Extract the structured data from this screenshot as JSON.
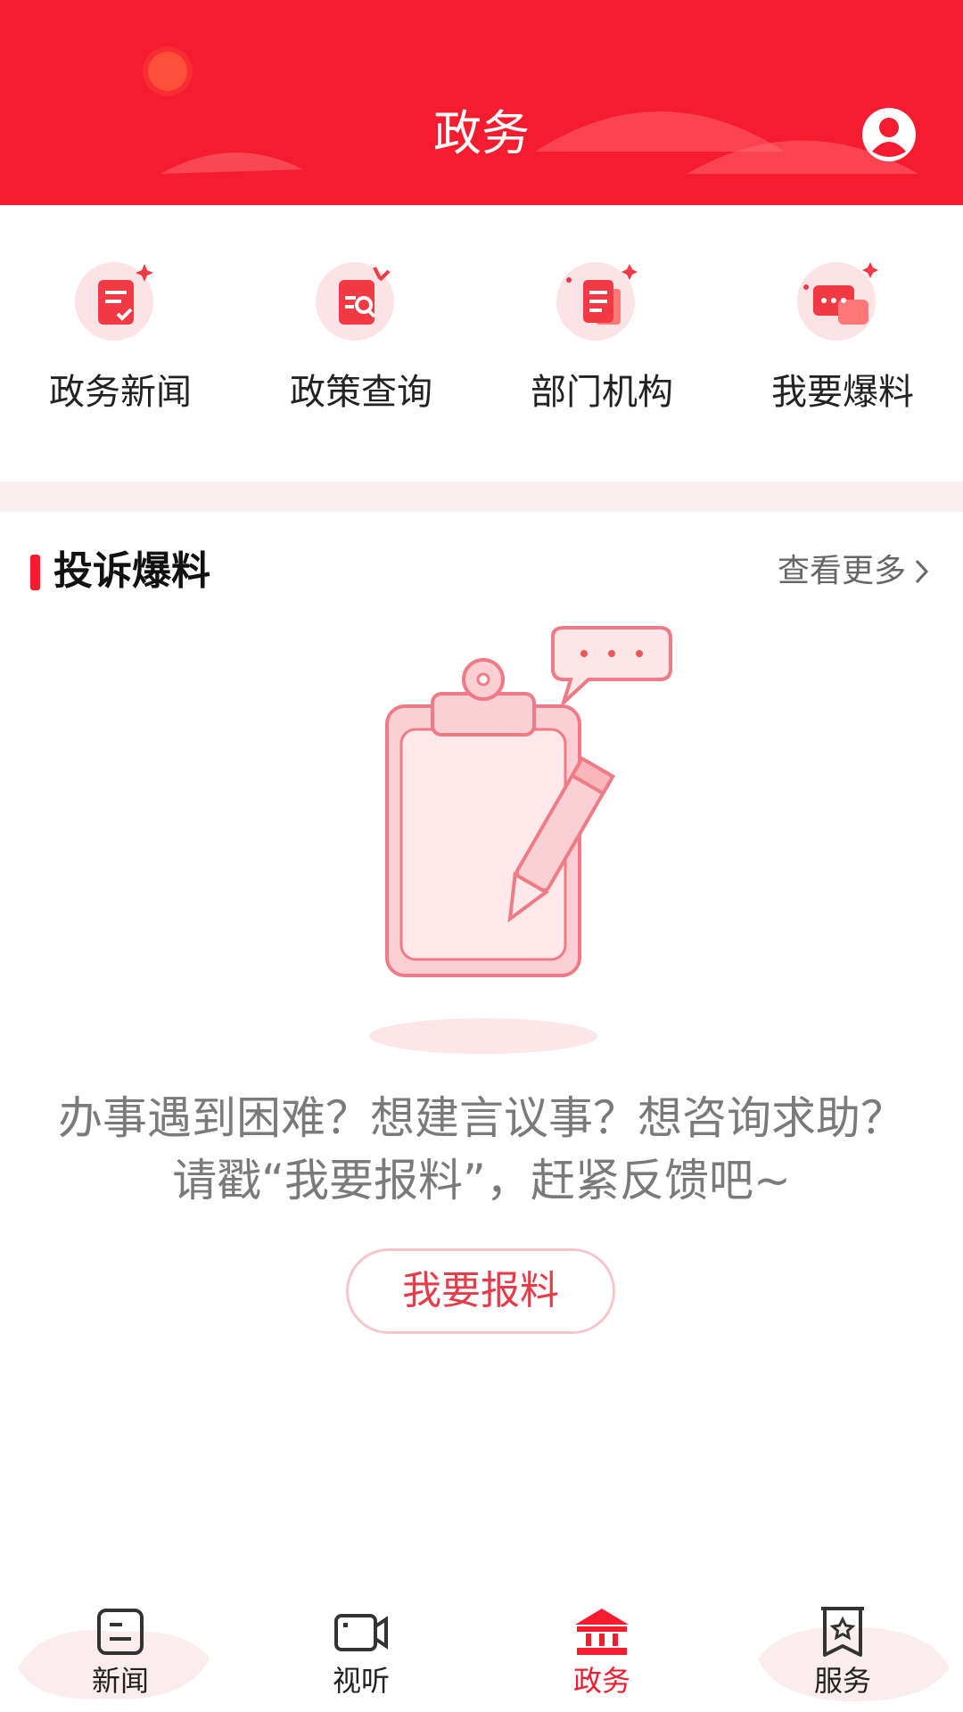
{
  "header": {
    "title": "政务"
  },
  "quick_entries": [
    {
      "label": "政务新闻",
      "icon": "news-doc-icon"
    },
    {
      "label": "政策查询",
      "icon": "policy-search-icon"
    },
    {
      "label": "部门机构",
      "icon": "department-icon"
    },
    {
      "label": "我要爆料",
      "icon": "chat-report-icon"
    }
  ],
  "section": {
    "title": "投诉爆料",
    "more": "查看更多"
  },
  "empty_state": {
    "line1": "办事遇到困难？想建言议事？想咨询求助？",
    "line2": "请戳“我要报料”，赶紧反馈吧~",
    "button": "我要报料"
  },
  "bottom_nav": [
    {
      "label": "新闻",
      "icon": "news-icon",
      "active": false
    },
    {
      "label": "视听",
      "icon": "video-icon",
      "active": false
    },
    {
      "label": "政务",
      "icon": "government-building-icon",
      "active": true
    },
    {
      "label": "服务",
      "icon": "service-bookmark-icon",
      "active": false
    }
  ],
  "colors": {
    "primary": "#f41c2e",
    "soft_pink": "#fde3e6",
    "text_gray": "#7a7a7a"
  }
}
